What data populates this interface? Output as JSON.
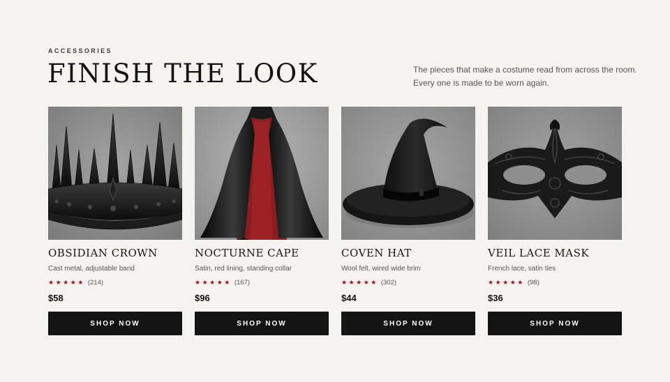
{
  "section": {
    "eyebrow": "ACCESSORIES",
    "title": "FINISH THE LOOK",
    "tagline_line1": "The pieces that make a costume read from across the room.",
    "tagline_line2": "Every one is made to be worn again."
  },
  "products": [
    {
      "name": "OBSIDIAN CROWN",
      "description": "Cast metal, adjustable band",
      "stars": "★★★★★",
      "review_count": "(214)",
      "price": "$58",
      "button": "SHOP NOW",
      "image_icon": "crown-image"
    },
    {
      "name": "NOCTURNE CAPE",
      "description": "Satin, red lining, standing collar",
      "stars": "★★★★★",
      "review_count": "(167)",
      "price": "$96",
      "button": "SHOP NOW",
      "image_icon": "cape-image"
    },
    {
      "name": "COVEN HAT",
      "description": "Wool felt, wired wide brim",
      "stars": "★★★★★",
      "review_count": "(302)",
      "price": "$44",
      "button": "SHOP NOW",
      "image_icon": "witch-hat-image"
    },
    {
      "name": "VEIL LACE MASK",
      "description": "French lace, satin ties",
      "stars": "★★★★★",
      "review_count": "(98)",
      "price": "$36",
      "button": "SHOP NOW",
      "image_icon": "lace-mask-image"
    }
  ],
  "colors": {
    "background": "#f5f3ef",
    "button": "#141414",
    "star": "#8c1b1b",
    "photo_bg": "#8e8e8e"
  }
}
